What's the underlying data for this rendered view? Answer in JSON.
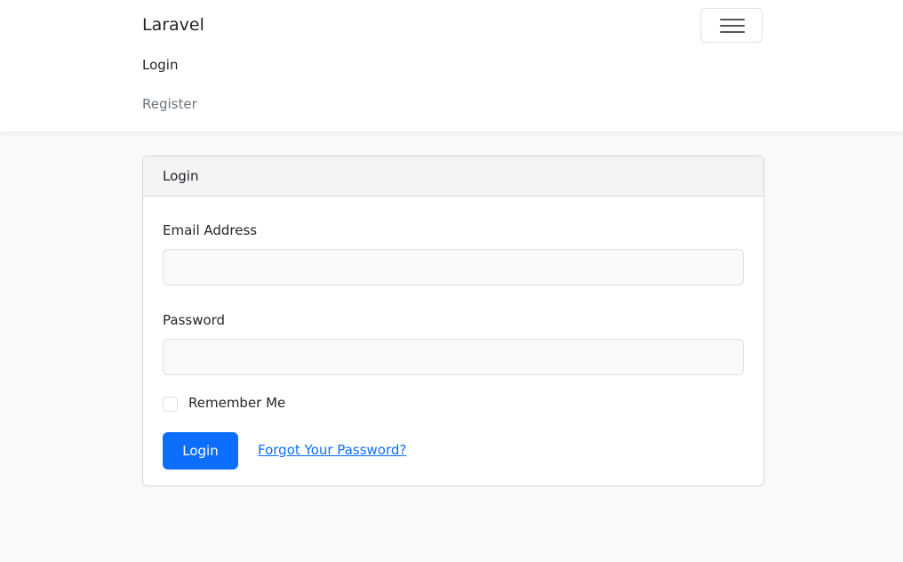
{
  "navbar": {
    "brand": "Laravel",
    "links": [
      {
        "label": "Login"
      },
      {
        "label": "Register"
      }
    ]
  },
  "card": {
    "header": "Login",
    "email": {
      "label": "Email Address",
      "value": "",
      "placeholder": ""
    },
    "password": {
      "label": "Password",
      "value": "",
      "placeholder": ""
    },
    "remember": {
      "label": "Remember Me",
      "checked": false
    },
    "submit_label": "Login",
    "forgot_label": "Forgot Your Password?"
  },
  "colors": {
    "primary": "#0d6efd",
    "background": "#f8f9fa",
    "navbar": "#ffffff",
    "card_header": "#f3f4f5"
  },
  "icons": {
    "menu": "hamburger-menu-icon"
  }
}
